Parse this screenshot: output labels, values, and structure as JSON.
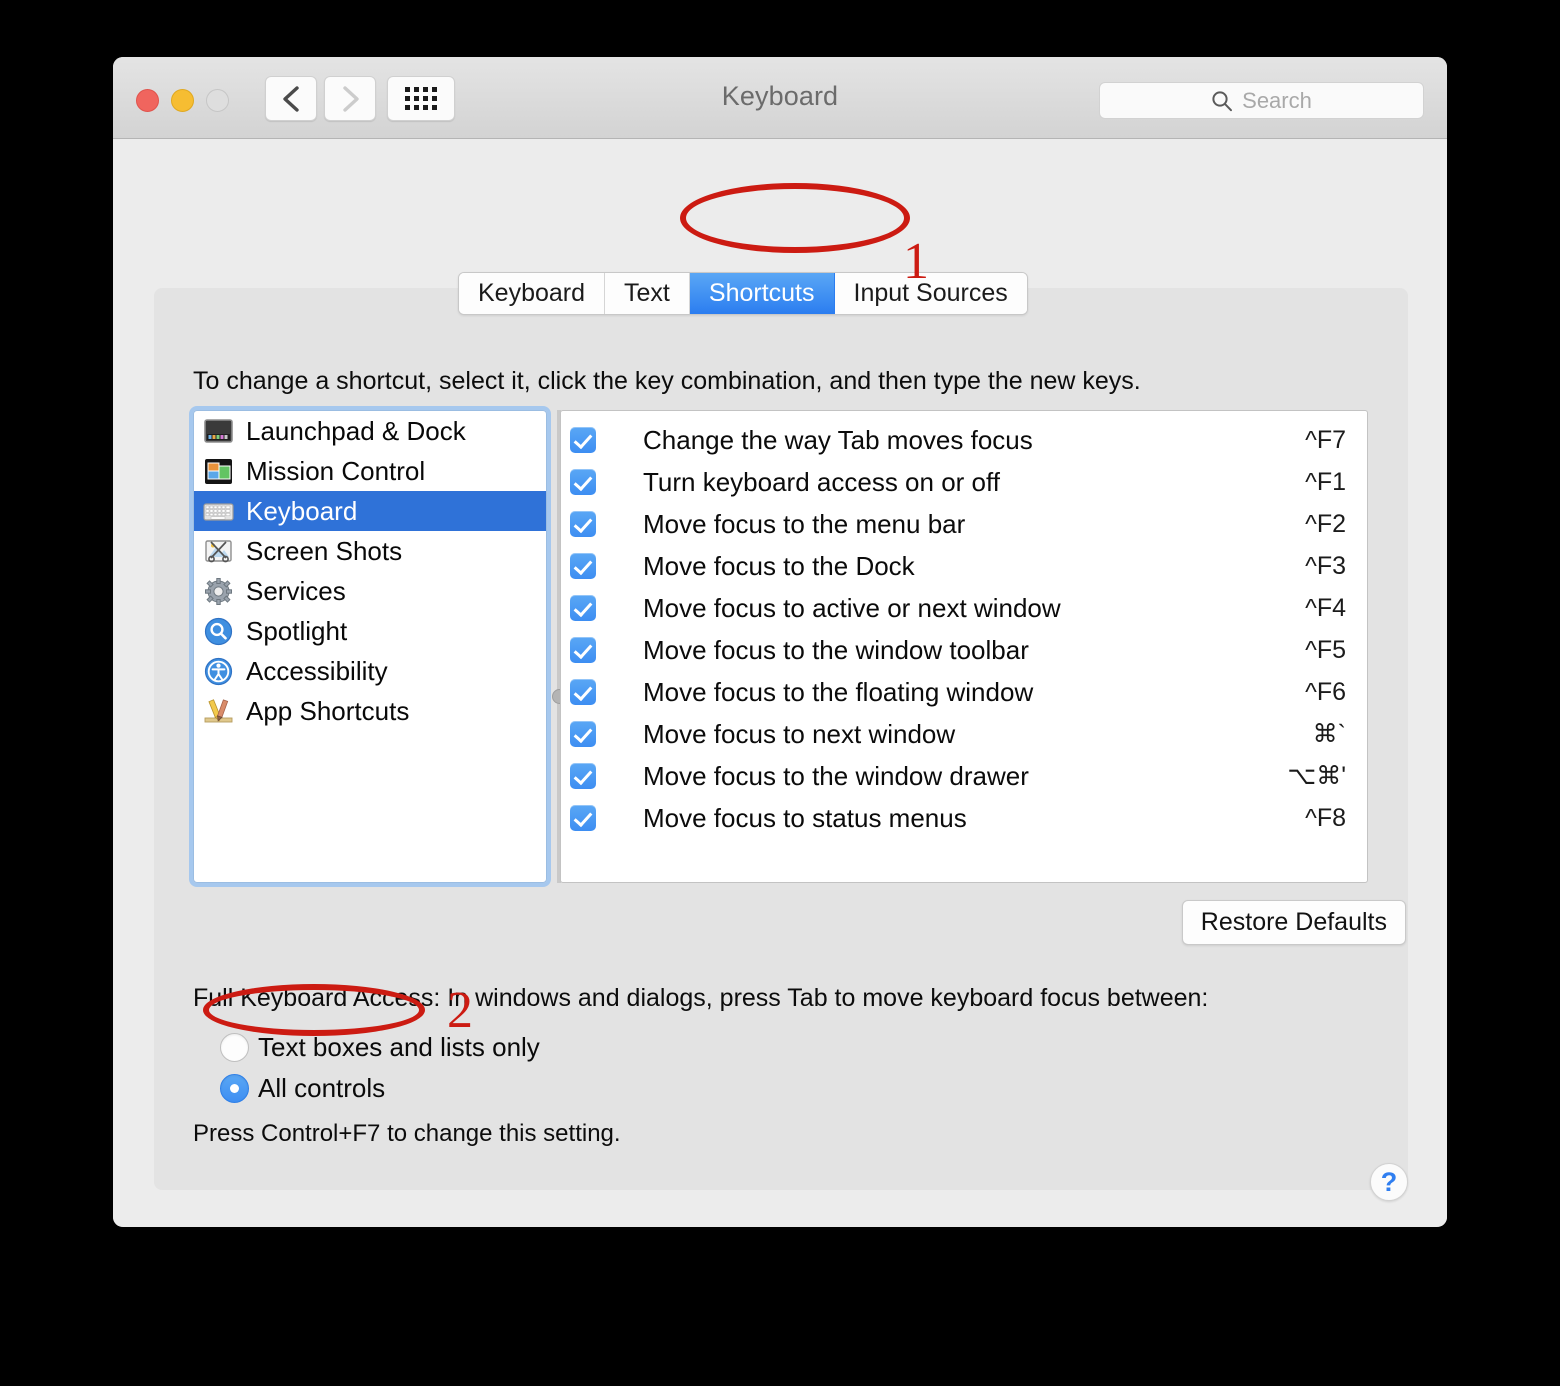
{
  "window": {
    "title": "Keyboard",
    "traffic_lights": [
      "close",
      "minimize",
      "zoom"
    ],
    "nav_back": "‹",
    "nav_forward": "›",
    "show_all_label": "show-all-grid"
  },
  "search": {
    "placeholder": "Search",
    "icon": "search-icon"
  },
  "tabs": [
    {
      "label": "Keyboard",
      "active": false
    },
    {
      "label": "Text",
      "active": false
    },
    {
      "label": "Shortcuts",
      "active": true
    },
    {
      "label": "Input Sources",
      "active": false
    }
  ],
  "helper_text": "To change a shortcut, select it, click the key combination, and then type the new keys.",
  "sidebar": {
    "items": [
      {
        "label": "Launchpad & Dock",
        "icon": "launchpad-dock-icon",
        "selected": false
      },
      {
        "label": "Mission Control",
        "icon": "mission-control-icon",
        "selected": false
      },
      {
        "label": "Keyboard",
        "icon": "keyboard-icon",
        "selected": true
      },
      {
        "label": "Screen Shots",
        "icon": "screenshots-icon",
        "selected": false
      },
      {
        "label": "Services",
        "icon": "services-gear-icon",
        "selected": false
      },
      {
        "label": "Spotlight",
        "icon": "spotlight-icon",
        "selected": false
      },
      {
        "label": "Accessibility",
        "icon": "accessibility-icon",
        "selected": false
      },
      {
        "label": "App Shortcuts",
        "icon": "app-shortcuts-icon",
        "selected": false
      }
    ]
  },
  "shortcuts": [
    {
      "name": "Change the way Tab moves focus",
      "key": "^F7",
      "checked": true
    },
    {
      "name": "Turn keyboard access on or off",
      "key": "^F1",
      "checked": true
    },
    {
      "name": "Move focus to the menu bar",
      "key": "^F2",
      "checked": true
    },
    {
      "name": "Move focus to the Dock",
      "key": "^F3",
      "checked": true
    },
    {
      "name": "Move focus to active or next window",
      "key": "^F4",
      "checked": true
    },
    {
      "name": "Move focus to the window toolbar",
      "key": "^F5",
      "checked": true
    },
    {
      "name": "Move focus to the floating window",
      "key": "^F6",
      "checked": true
    },
    {
      "name": "Move focus to next window",
      "key": "⌘`",
      "checked": true
    },
    {
      "name": "Move focus to the window drawer",
      "key": "⌥⌘'",
      "checked": true
    },
    {
      "name": "Move focus to status menus",
      "key": "^F8",
      "checked": true
    }
  ],
  "restore_defaults_label": "Restore Defaults",
  "full_keyboard_access": {
    "title": "Full Keyboard Access: In windows and dialogs, press Tab to move keyboard focus between:",
    "options": [
      {
        "label": "Text boxes and lists only",
        "selected": false
      },
      {
        "label": "All controls",
        "selected": true
      }
    ],
    "note": "Press Control+F7 to change this setting."
  },
  "help_label": "?",
  "annotations": [
    {
      "number": "1",
      "target": "Shortcuts tab",
      "color": "#cc1b12"
    },
    {
      "number": "2",
      "target": "All controls radio",
      "color": "#cc1b12"
    }
  ]
}
